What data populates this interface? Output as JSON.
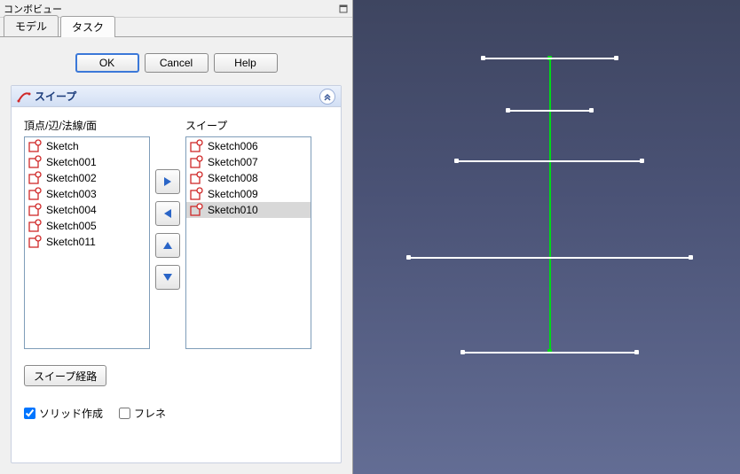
{
  "panel": {
    "title": "コンボビュー"
  },
  "tabs": {
    "model": "モデル",
    "task": "タスク"
  },
  "buttons": {
    "ok": "OK",
    "cancel": "Cancel",
    "help": "Help"
  },
  "sweep": {
    "title": "スイープ",
    "left_label": "頂点/辺/法線/面",
    "right_label": "スイープ",
    "left_items": [
      "Sketch",
      "Sketch001",
      "Sketch002",
      "Sketch003",
      "Sketch004",
      "Sketch005",
      "Sketch011"
    ],
    "right_items": [
      "Sketch006",
      "Sketch007",
      "Sketch008",
      "Sketch009",
      "Sketch010"
    ],
    "right_selected_index": 4,
    "path_button": "スイープ経路",
    "solid_label": "ソリッド作成",
    "frenet_label": "フレネ"
  }
}
